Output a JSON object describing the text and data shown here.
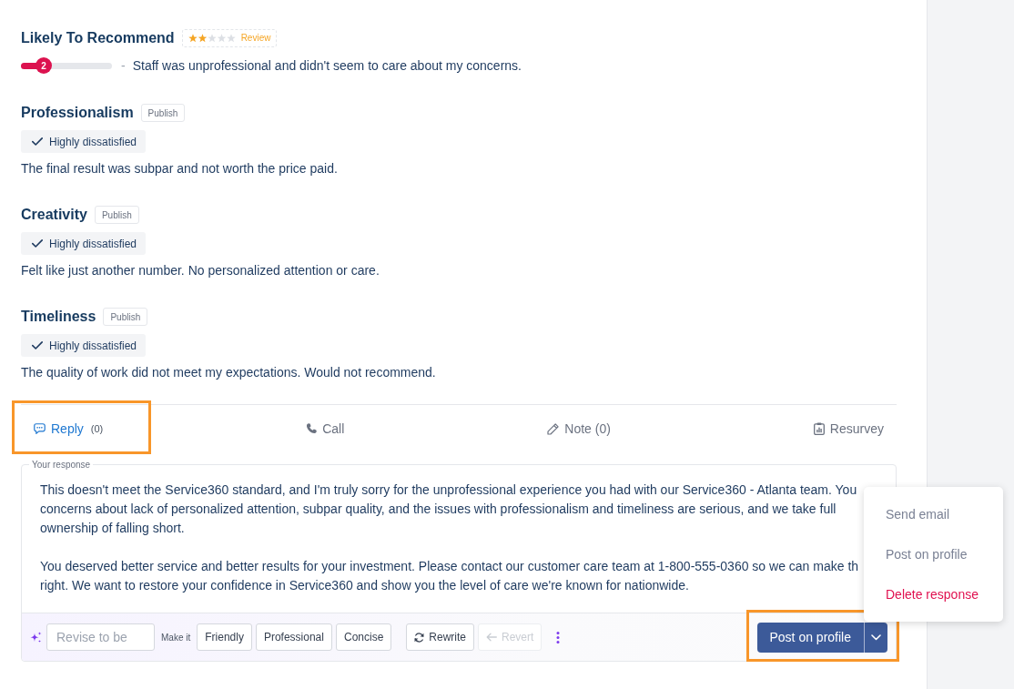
{
  "questions": [
    {
      "kind": "rating",
      "title": "Likely To Recommend",
      "badge": {
        "stars": 2,
        "label": "Review"
      },
      "scale": {
        "level": 0.25,
        "value": "2"
      },
      "separator": "-",
      "comment": "Staff was unprofessional and didn't seem to care about my concerns."
    },
    {
      "kind": "choice",
      "title": "Professionalism",
      "tag": "Publish",
      "answer": "Highly dissatisfied",
      "comment": "The final result was subpar and not worth the price paid."
    },
    {
      "kind": "choice",
      "title": "Creativity",
      "tag": "Publish",
      "answer": "Highly dissatisfied",
      "comment": "Felt like just another number. No personalized attention or care."
    },
    {
      "kind": "choice",
      "title": "Timeliness",
      "tag": "Publish",
      "answer": "Highly dissatisfied",
      "comment": "The quality of work did not meet my expectations. Would not recommend."
    }
  ],
  "tabs": [
    {
      "label": "Reply",
      "count": "(0)",
      "selected": true,
      "highlighted": true
    },
    {
      "label": "Call",
      "selected": false,
      "highlighted": false
    },
    {
      "label": "Note (0)",
      "selected": false,
      "highlighted": false
    },
    {
      "label": "Resurvey",
      "selected": false,
      "highlighted": false
    }
  ],
  "response": {
    "legend": "Your response",
    "paragraphs": [
      {
        "lines": [
          "This doesn't meet the Service360 standard, and I'm truly sorry for the unprofessional experience you had with our Service360 - Atlanta team. You",
          "concerns about lack of personalized attention, subpar quality, and the issues with professionalism and timeliness are serious, and we take full",
          "ownership of falling short."
        ]
      },
      {
        "lines": [
          "You deserved better service and better results for your investment. Please contact our customer care team at 1-800-555-0360 so we can make th",
          "right. We want to restore your confidence in Service360 and show you the level of care we're known for nationwide."
        ]
      }
    ]
  },
  "assistant": {
    "placeholder": "Revise to be",
    "make_it_label": "Make it",
    "tones": [
      "Friendly",
      "Professional",
      "Concise"
    ],
    "rewrite": {
      "label": "Rewrite",
      "disabled": false
    },
    "revert": {
      "label": "Revert",
      "disabled": true
    }
  },
  "post_button": {
    "label": "Post on profile",
    "highlighted": true,
    "expanded": true
  },
  "post_menu": {
    "items": [
      {
        "label": "Send email",
        "kind": "default"
      },
      {
        "label": "Post on profile",
        "kind": "default"
      },
      {
        "label": "Delete response",
        "kind": "danger"
      }
    ]
  }
}
